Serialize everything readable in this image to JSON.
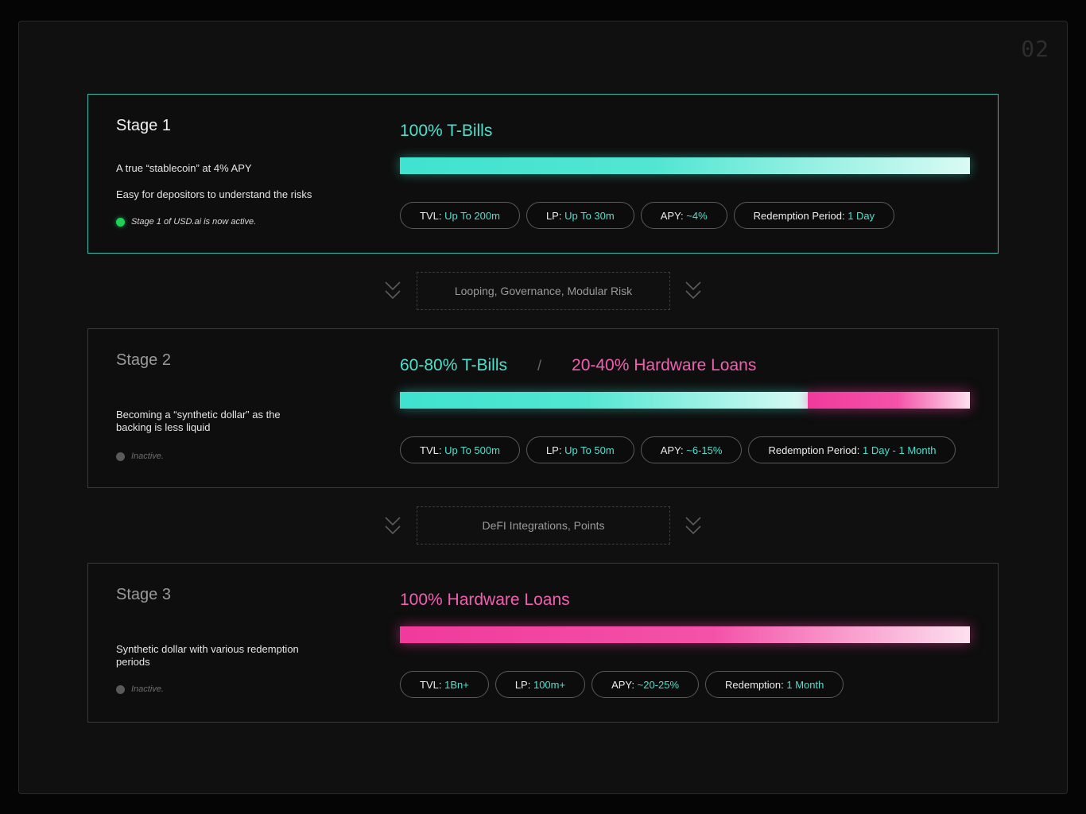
{
  "page_number": "02",
  "colors": {
    "teal": "#4ee0cc",
    "pink": "#f060b0",
    "active_dot": "#1fd15a",
    "inactive_dot": "#5a5a5a"
  },
  "stages": [
    {
      "title": "Stage 1",
      "desc": [
        "A true “stablecoin” at 4% APY",
        "Easy for depositors to understand the risks"
      ],
      "status": "Stage 1 of USD.ai is now active.",
      "active": true,
      "alloc_teal": "100% T-Bills",
      "bar_teal_fraction": 1.0,
      "pills": [
        {
          "k": "TVL:",
          "v": "Up To 200m"
        },
        {
          "k": "LP:",
          "v": "Up To 30m"
        },
        {
          "k": "APY:",
          "v": "~4%"
        },
        {
          "k": "Redemption Period:",
          "v": "1 Day"
        }
      ]
    },
    {
      "title": "Stage 2",
      "desc": [
        "Becoming a “synthetic dollar” as the backing is less liquid"
      ],
      "status": "Inactive.",
      "active": false,
      "alloc_teal": "60-80% T-Bills",
      "alloc_sep": "/",
      "alloc_pink": "20-40% Hardware Loans",
      "bar_teal_fraction": 0.715,
      "pills": [
        {
          "k": "TVL:",
          "v": "Up To 500m"
        },
        {
          "k": "LP:",
          "v": "Up To 50m"
        },
        {
          "k": "APY:",
          "v": "~6-15%"
        },
        {
          "k": "Redemption Period:",
          "v": "1 Day - 1 Month"
        }
      ]
    },
    {
      "title": "Stage 3",
      "desc": [
        "Synthetic dollar with various redemption periods"
      ],
      "status": "Inactive.",
      "active": false,
      "alloc_pink": "100% Hardware Loans",
      "bar_teal_fraction": 0.0,
      "pills": [
        {
          "k": "TVL:",
          "v": "1Bn+"
        },
        {
          "k": "LP:",
          "v": "100m+"
        },
        {
          "k": "APY:",
          "v": "~20-25%"
        },
        {
          "k": "Redemption:",
          "v": "1 Month"
        }
      ]
    }
  ],
  "connectors": [
    {
      "label": "Looping, Governance, Modular Risk"
    },
    {
      "label": "DeFI Integrations, Points"
    }
  ]
}
